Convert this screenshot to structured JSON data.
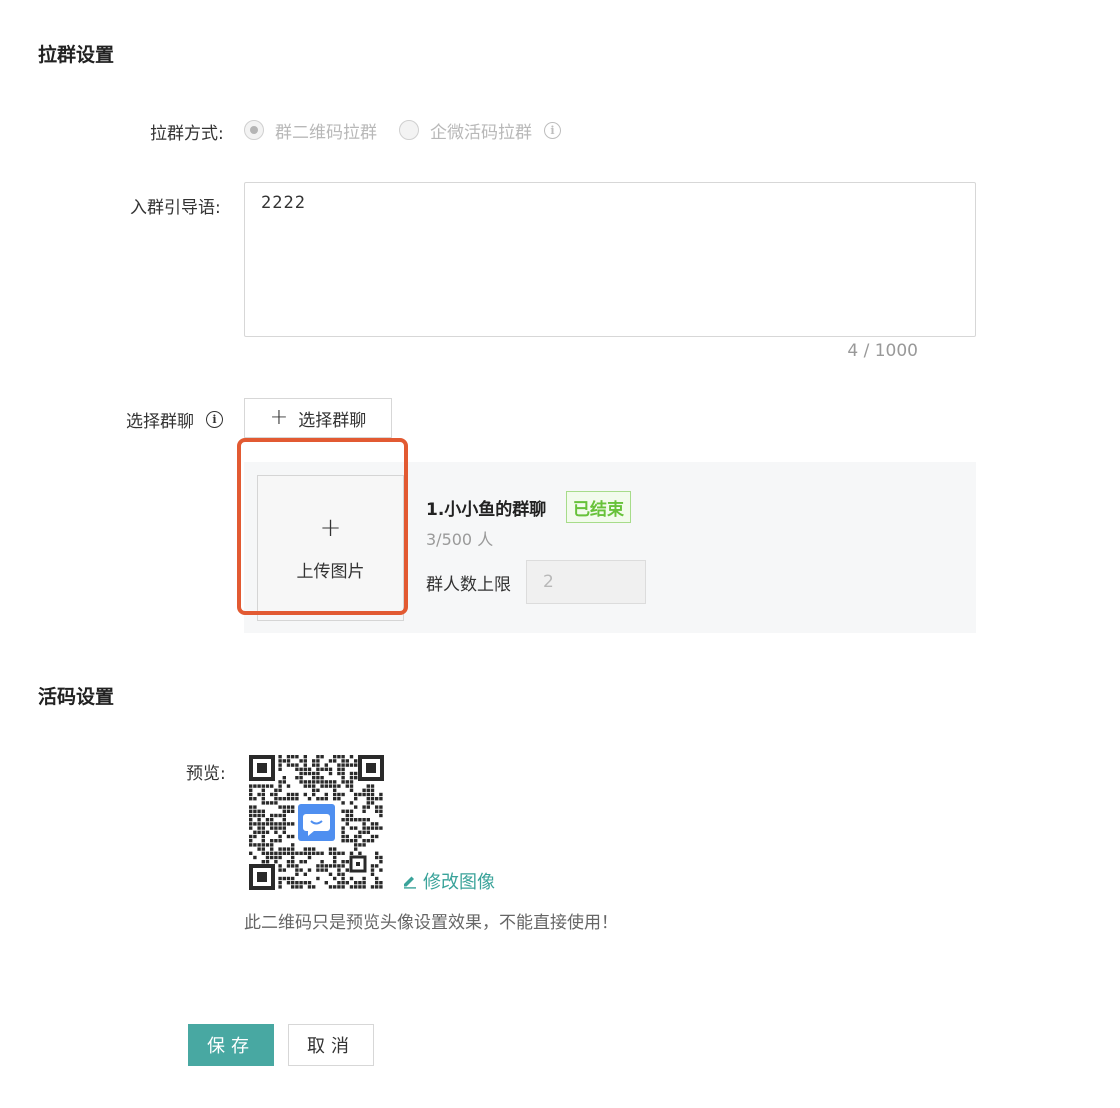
{
  "group_settings": {
    "title": "拉群设置",
    "method_label": "拉群方式:",
    "method_options": [
      {
        "label": "群二维码拉群",
        "checked": true
      },
      {
        "label": "企微活码拉群",
        "checked": false
      }
    ],
    "guide_label": "入群引导语:",
    "guide_value": "2222",
    "guide_counter": "4 / 1000",
    "select_label": "选择群聊",
    "select_button": "选择群聊",
    "upload_text": "上传图片",
    "group": {
      "name": "1.小小鱼的群聊",
      "status": "已结束",
      "members": "3/500 人",
      "limit_label": "群人数上限",
      "limit_value": "2"
    }
  },
  "qr_settings": {
    "title": "活码设置",
    "preview_label": "预览:",
    "edit_link": "修改图像",
    "hint": "此二维码只是预览头像设置效果，不能直接使用！"
  },
  "actions": {
    "save": "保存",
    "cancel": "取消"
  },
  "colors": {
    "accent": "#48a8a2",
    "link": "#3aa39a",
    "status_green": "#67c23a",
    "highlight": "#e25a32"
  },
  "icons": [
    "info-icon",
    "plus-icon",
    "edit-icon",
    "qr-code",
    "chat-bubble-icon"
  ]
}
